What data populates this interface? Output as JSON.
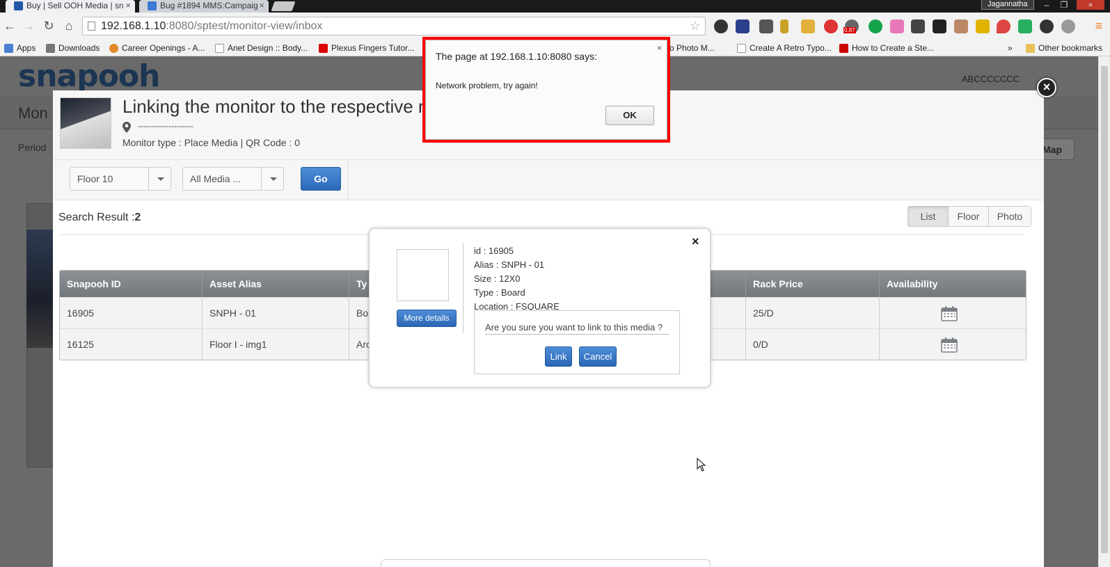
{
  "browser": {
    "tabs": [
      {
        "title": "Buy | Sell OOH Media | sn"
      },
      {
        "title": "Bug #1894 MMS:Campaig"
      }
    ],
    "user": "Jagannatha",
    "address_host": "192.168.1.10",
    "address_path": ":8080/sptest/monitor-view/inbox",
    "extension_badge": "0.87",
    "bookmarks": [
      "Apps",
      "Downloads",
      "Career Openings - A...",
      "Anet Design :: Body...",
      "Plexus Fingers Tutor...",
      "o Photo M...",
      "Create A Retro Typo...",
      "How to Create a Ste..."
    ],
    "bookmarks_more": "»",
    "other_bookmarks": "Other bookmarks"
  },
  "background_page": {
    "logo": "snapooh",
    "user": "ABCCCCCCC",
    "title": "Mon",
    "period": "Period",
    "map_button": "Map"
  },
  "modal": {
    "title": "Linking the monitor to the respective r",
    "location": "--------------------",
    "meta": "Monitor type : Place Media | QR Code : 0",
    "filters": {
      "floor": "Floor 10",
      "media": "All Media ...",
      "go": "Go"
    },
    "search_result_label": "Search Result :",
    "search_result_count": "2",
    "views": [
      "List",
      "Floor",
      "Photo"
    ],
    "table": {
      "columns": [
        "Snapooh ID",
        "Asset Alias",
        "Ty",
        "",
        "Rack Price",
        "Availability"
      ],
      "rows": [
        {
          "id": "16905",
          "alias": "SNPH - 01",
          "type": "Bo",
          "rack_price": "25/D"
        },
        {
          "id": "16125",
          "alias": "Floor I - img1",
          "type": "Arc",
          "rack_price": "0/D"
        }
      ]
    }
  },
  "link_popup": {
    "info": {
      "id": "id : 16905",
      "alias": "Alias : SNPH - 01",
      "size": "Size : 12X0",
      "type": "Type : Board",
      "location": "Location : FSQUARE"
    },
    "more_details": "More details",
    "question": "Are you sure you want to link to this media ?",
    "link_button": "Link",
    "cancel_button": "Cancel",
    "close": "×"
  },
  "alert": {
    "title": "The page at 192.168.1.10:8080 says:",
    "message": "Network problem, try again!",
    "ok": "OK",
    "close": "×"
  },
  "colors": {
    "primary_button": "#2b69b8",
    "alert_highlight": "#ff0000",
    "table_header": "#7d8287",
    "logo": "#1b3552"
  }
}
